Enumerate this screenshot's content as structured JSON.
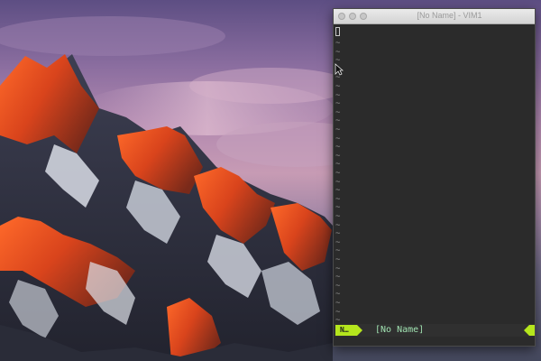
{
  "window": {
    "title": "[No Name] - VIM1"
  },
  "editor": {
    "empty_line_marker": "~",
    "empty_line_count": 33
  },
  "statusline": {
    "mode": "N…",
    "filename": "[No Name]"
  },
  "colors": {
    "statusline_accent": "#b5e61d",
    "filename": "#9fe0b0",
    "editor_bg": "#2b2b2b",
    "tilde": "#8d8d8d"
  },
  "icons": {
    "close": "close-dot-icon",
    "minimize": "minimize-dot-icon",
    "zoom": "zoom-dot-icon",
    "pointer": "mouse-pointer-icon"
  }
}
